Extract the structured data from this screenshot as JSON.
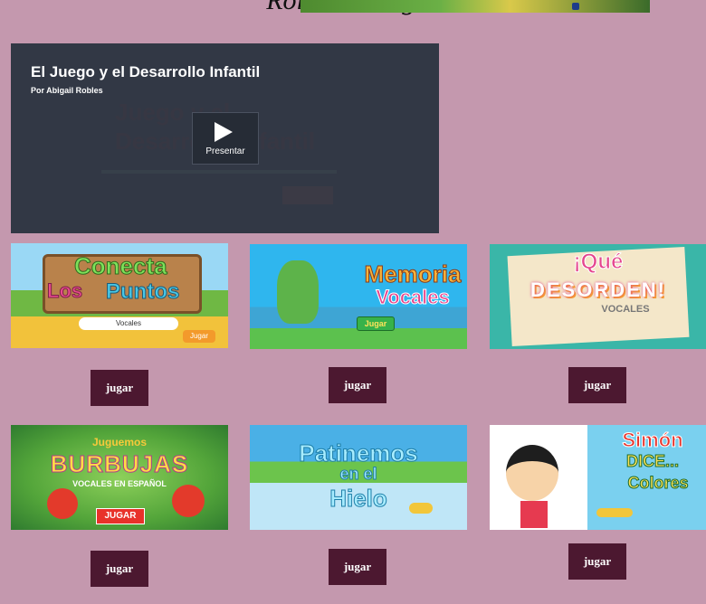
{
  "page": {
    "title": "Rollo de Juegos"
  },
  "presentation": {
    "title": "El Juego y el Desarrollo Infantil",
    "author": "Por Abigail Robles",
    "ghost_text": "Juego y el Desarrollo Infantil",
    "play_label": "Presentar"
  },
  "games": [
    {
      "line1": "Conecta",
      "line2": "Los",
      "line3": "Puntos",
      "caption": "Vocales",
      "button_label": "Jugar",
      "action_label": "jugar"
    },
    {
      "line1": "Memoria",
      "line2": "Vocales",
      "button_label": "Jugar",
      "action_label": "jugar"
    },
    {
      "line1": "¡Qué",
      "line2": "DESORDEN!",
      "line3": "VOCALES",
      "action_label": "jugar"
    },
    {
      "line1": "Juguemos",
      "line2": "BURBUJAS",
      "line3": "VOCALES EN ESPAÑOL",
      "button_label": "JUGAR",
      "action_label": "jugar"
    },
    {
      "line1": "Patinemos",
      "line2": "en el",
      "line3": "Hielo",
      "action_label": "jugar"
    },
    {
      "line1": "Simón",
      "line2": "DICE...",
      "line3": "Colores",
      "action_label": "jugar"
    }
  ]
}
